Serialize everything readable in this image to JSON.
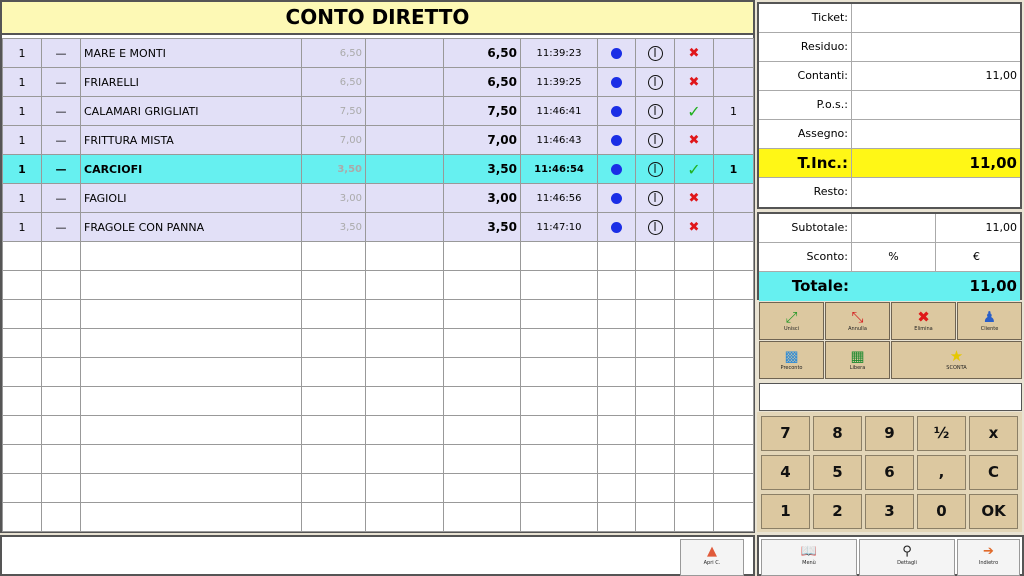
{
  "title": "CONTO DIRETTO",
  "rows": [
    {
      "qty": "1",
      "dash": "—",
      "name": "MARE E MONTI",
      "unit": "6,50",
      "total": "6,50",
      "time": "11:39:23",
      "mark": "x",
      "extra": ""
    },
    {
      "qty": "1",
      "dash": "—",
      "name": "FRIARELLI",
      "unit": "6,50",
      "total": "6,50",
      "time": "11:39:25",
      "mark": "x",
      "extra": ""
    },
    {
      "qty": "1",
      "dash": "—",
      "name": "CALAMARI GRIGLIATI",
      "unit": "7,50",
      "total": "7,50",
      "time": "11:46:41",
      "mark": "check",
      "extra": "1"
    },
    {
      "qty": "1",
      "dash": "—",
      "name": "FRITTURA MISTA",
      "unit": "7,00",
      "total": "7,00",
      "time": "11:46:43",
      "mark": "x",
      "extra": ""
    },
    {
      "qty": "1",
      "dash": "—",
      "name": "CARCIOFI",
      "unit": "3,50",
      "total": "3,50",
      "time": "11:46:54",
      "mark": "check",
      "extra": "1",
      "selected": true
    },
    {
      "qty": "1",
      "dash": "—",
      "name": "FAGIOLI",
      "unit": "3,00",
      "total": "3,00",
      "time": "11:46:56",
      "mark": "x",
      "extra": ""
    },
    {
      "qty": "1",
      "dash": "—",
      "name": "FRAGOLE CON PANNA",
      "unit": "3,50",
      "total": "3,50",
      "time": "11:47:10",
      "mark": "x",
      "extra": ""
    }
  ],
  "payment": {
    "ticket_label": "Ticket:",
    "ticket_value": "",
    "residuo_label": "Residuo:",
    "residuo_value": "",
    "contanti_label": "Contanti:",
    "contanti_value": "11,00",
    "pos_label": "P.o.s.:",
    "pos_value": "",
    "assegno_label": "Assegno:",
    "assegno_value": "",
    "tinc_label": "T.Inc.:",
    "tinc_value": "11,00",
    "resto_label": "Resto:",
    "resto_value": ""
  },
  "totals": {
    "subtotale_label": "Subtotale:",
    "subtotale_value": "11,00",
    "sconto_label": "Sconto:",
    "sconto_pct": "%",
    "sconto_eur": "€",
    "totale_label": "Totale:",
    "totale_value": "11,00"
  },
  "actions": {
    "unisci": "Unisci",
    "annulla": "Annulla",
    "elimina": "Elimina",
    "cliente": "Cliente",
    "preconto": "Preconto",
    "libera": "Libera",
    "sconto": "SCONTA"
  },
  "keypad": [
    "7",
    "8",
    "9",
    "½",
    "x",
    "4",
    "5",
    "6",
    ",",
    "C",
    "1",
    "2",
    "3",
    "0",
    "OK"
  ],
  "bottom": {
    "apri": "Apri C.",
    "menu": "Menù",
    "dettagli": "Dettagli",
    "indietro": "Indietro"
  },
  "colors": {
    "header_bg": "#fdf9b5",
    "row_bg": "#e2e0f7",
    "selected_bg": "#66f0f0",
    "tinc_bg": "#fff716",
    "button_bg": "#dcc8a0"
  }
}
